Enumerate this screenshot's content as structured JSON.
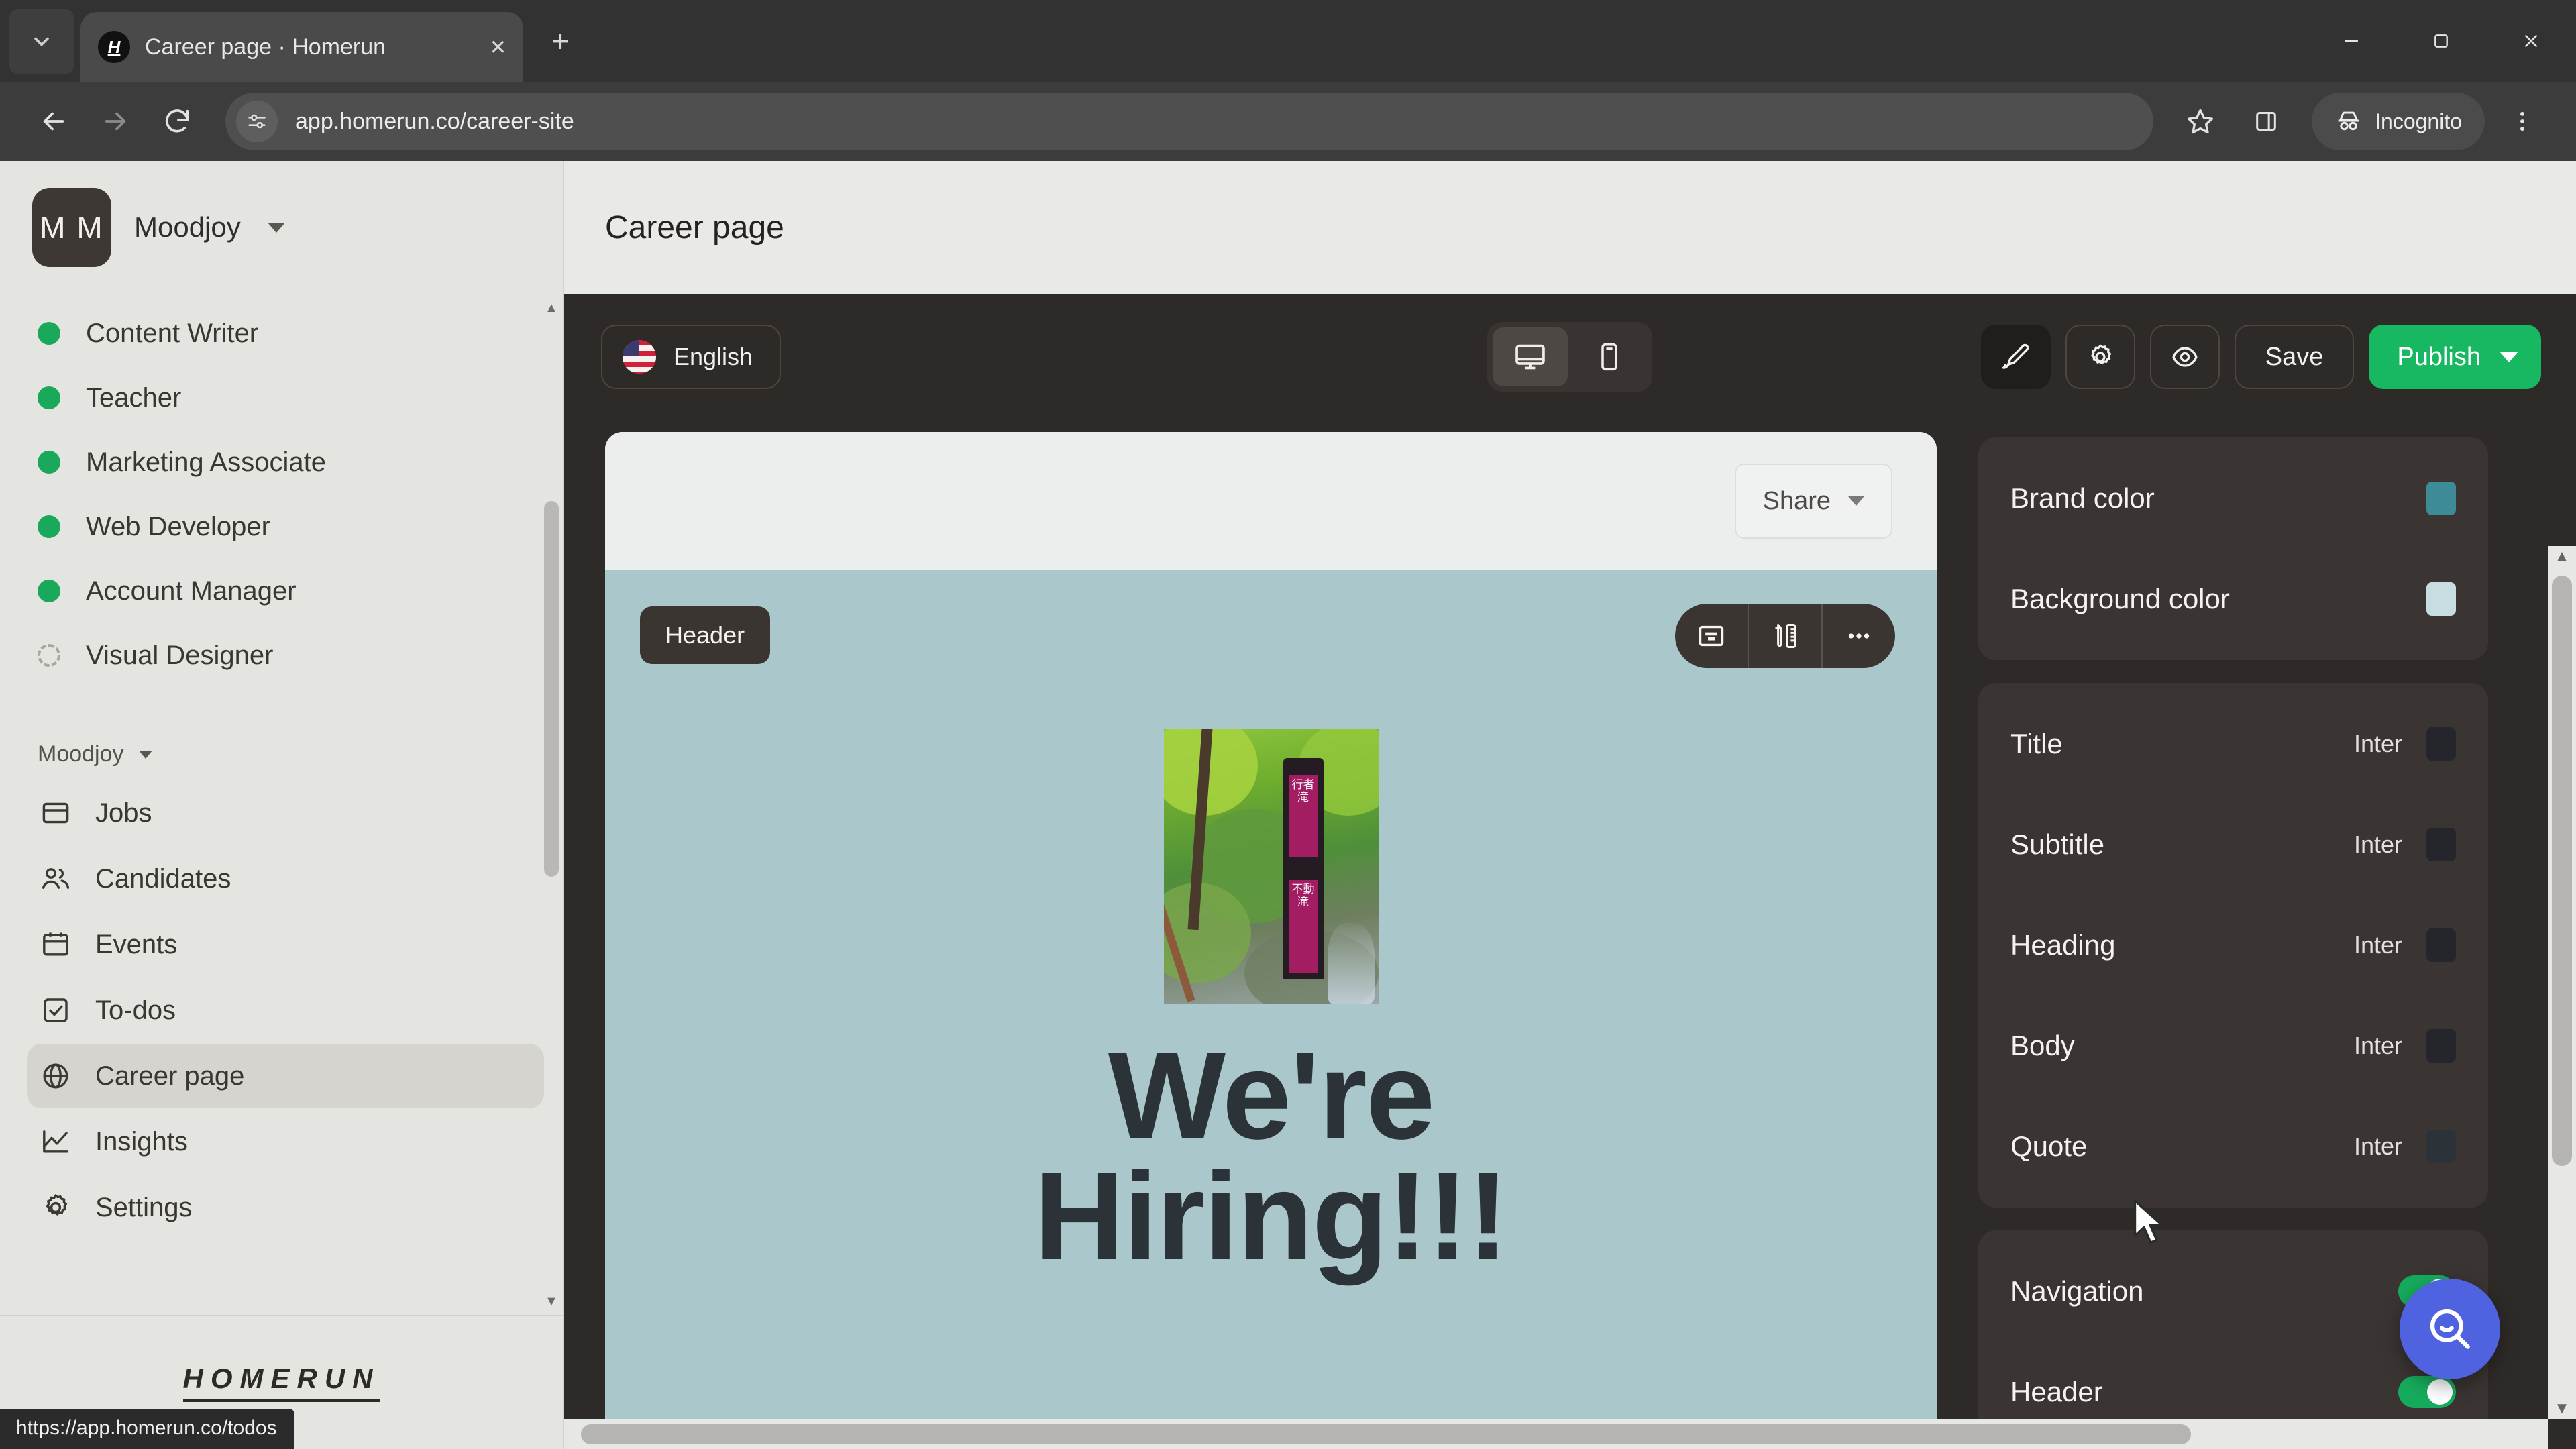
{
  "browser": {
    "tab": {
      "title": "Career page · Homerun",
      "favicon_letter": "H"
    },
    "new_tab_label": "+",
    "close_tab_label": "×",
    "url": "app.homerun.co/career-site",
    "profile_label": "Incognito",
    "status_url": "https://app.homerun.co/todos"
  },
  "sidebar": {
    "org": {
      "initials": "M M",
      "name": "Moodjoy"
    },
    "jobs": [
      {
        "label": "Content Writer",
        "status": "published"
      },
      {
        "label": "Teacher",
        "status": "published"
      },
      {
        "label": "Marketing Associate",
        "status": "published"
      },
      {
        "label": "Web Developer",
        "status": "published"
      },
      {
        "label": "Account Manager",
        "status": "published"
      },
      {
        "label": "Visual Designer",
        "status": "draft"
      }
    ],
    "group_label": "Moodjoy",
    "nav": [
      {
        "label": "Jobs",
        "icon": "jobs-icon",
        "active": false
      },
      {
        "label": "Candidates",
        "icon": "candidates-icon",
        "active": false
      },
      {
        "label": "Events",
        "icon": "events-icon",
        "active": false
      },
      {
        "label": "To-dos",
        "icon": "todos-icon",
        "active": false
      },
      {
        "label": "Career page",
        "icon": "globe-icon",
        "active": true
      },
      {
        "label": "Insights",
        "icon": "insights-icon",
        "active": false
      },
      {
        "label": "Settings",
        "icon": "gear-icon",
        "active": false
      }
    ],
    "footer_logo": "HOMERUN"
  },
  "page": {
    "title": "Career page"
  },
  "editor_toolbar": {
    "language": "English",
    "devices": [
      {
        "name": "desktop",
        "active": true
      },
      {
        "name": "mobile",
        "active": false
      }
    ],
    "design_button": "design",
    "settings_button": "settings",
    "preview_button": "preview",
    "save_label": "Save",
    "publish_label": "Publish"
  },
  "preview": {
    "share_label": "Share",
    "section_tag": "Header",
    "hero_title_line1": "We're",
    "hero_title_line2": "Hiring!!!",
    "image_sign_top": "行者滝",
    "image_sign_bottom": "不動滝",
    "section_tools": [
      "layout-icon",
      "design-icon",
      "more-icon"
    ]
  },
  "right_panel": {
    "colors": [
      {
        "label": "Brand color",
        "value": "#3d8b96"
      },
      {
        "label": "Background color",
        "value": "#c8dde2"
      }
    ],
    "typography": [
      {
        "label": "Title",
        "font": "Inter",
        "color": "#24262c"
      },
      {
        "label": "Subtitle",
        "font": "Inter",
        "color": "#24262c"
      },
      {
        "label": "Heading",
        "font": "Inter",
        "color": "#24262c"
      },
      {
        "label": "Body",
        "font": "Inter",
        "color": "#24262c"
      },
      {
        "label": "Quote",
        "font": "Inter",
        "color": "#2c3338"
      }
    ],
    "sections": [
      {
        "label": "Navigation",
        "enabled": true
      },
      {
        "label": "Header",
        "enabled": true
      }
    ]
  }
}
